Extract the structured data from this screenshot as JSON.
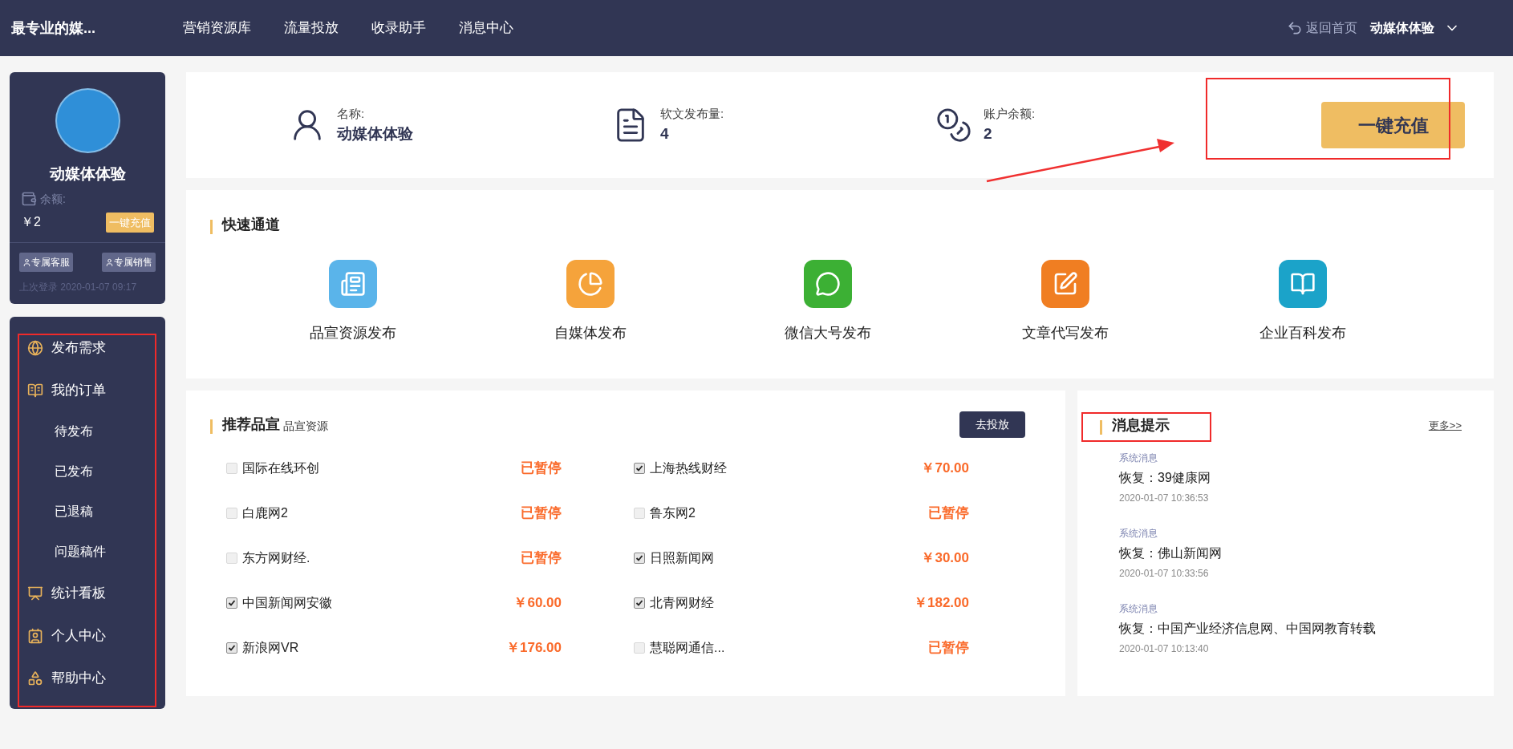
{
  "topbar": {
    "logo": "最专业的媒...",
    "nav": [
      {
        "label": "营销资源库"
      },
      {
        "label": "流量投放"
      },
      {
        "label": "收录助手"
      },
      {
        "label": "消息中心"
      }
    ],
    "home_link": "返回首页",
    "user": "动媒体体验"
  },
  "profile": {
    "name": "动媒体体验",
    "balance_label": "余额:",
    "balance": "￥2",
    "recharge": "一键充值",
    "buttons": [
      "专属客服",
      "专属销售"
    ],
    "last_login": "上次登录 2020-01-07 09:17"
  },
  "menu": [
    {
      "label": "发布需求"
    },
    {
      "label": "我的订单",
      "children": [
        {
          "label": "待发布"
        },
        {
          "label": "已发布"
        },
        {
          "label": "已退稿"
        },
        {
          "label": "问题稿件"
        }
      ]
    },
    {
      "label": "统计看板"
    },
    {
      "label": "个人中心"
    },
    {
      "label": "帮助中心"
    }
  ],
  "stats": [
    {
      "label": "名称:",
      "value": "动媒体体验"
    },
    {
      "label": "软文发布量:",
      "value": "4"
    },
    {
      "label": "账户余额:",
      "value": "2"
    }
  ],
  "recharge_button": "一键充值",
  "quick": {
    "title": "快速通道",
    "items": [
      {
        "label": "品宣资源发布",
        "color": "#5ab4ea"
      },
      {
        "label": "自媒体发布",
        "color": "#f5a33b"
      },
      {
        "label": "微信大号发布",
        "color": "#3cb034"
      },
      {
        "label": "文章代写发布",
        "color": "#f07e22"
      },
      {
        "label": "企业百科发布",
        "color": "#1ba3c9"
      }
    ]
  },
  "recommend": {
    "title": "推荐品宣",
    "subtitle": "品宣资源",
    "action": "去投放",
    "items": [
      {
        "name": "国际在线环创",
        "value": "已暂停",
        "checked": false
      },
      {
        "name": "上海热线财经",
        "value": "￥70.00",
        "checked": true
      },
      {
        "name": "白鹿网2",
        "value": "已暂停",
        "checked": false
      },
      {
        "name": "鲁东网2",
        "value": "已暂停",
        "checked": false
      },
      {
        "name": "东方网财经.",
        "value": "已暂停",
        "checked": false
      },
      {
        "name": "日照新闻网",
        "value": "￥30.00",
        "checked": true
      },
      {
        "name": "中国新闻网安徽",
        "value": "￥60.00",
        "checked": true
      },
      {
        "name": "北青网财经",
        "value": "￥182.00",
        "checked": true
      },
      {
        "name": "新浪网VR",
        "value": "￥176.00",
        "checked": true
      },
      {
        "name": "慧聪网通信...",
        "value": "已暂停",
        "checked": false
      }
    ]
  },
  "messages": {
    "title": "消息提示",
    "more": "更多>>",
    "items": [
      {
        "type": "系统消息",
        "text": "恢复：39健康网",
        "time": "2020-01-07 10:36:53"
      },
      {
        "type": "系统消息",
        "text": "恢复：佛山新闻网",
        "time": "2020-01-07 10:33:56"
      },
      {
        "type": "系统消息",
        "text": "恢复：中国产业经济信息网、中国网教育转载",
        "time": "2020-01-07 10:13:40"
      }
    ]
  }
}
